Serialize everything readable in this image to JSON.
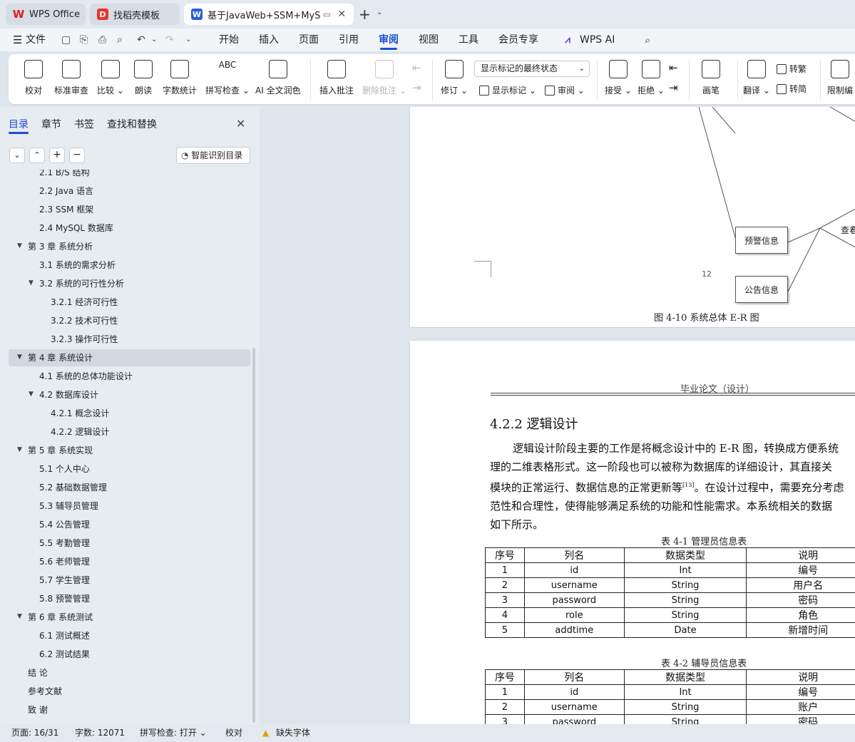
{
  "tabs": [
    {
      "label": "WPS Office",
      "icon": "wps-logo-icon",
      "color": "#d9201c"
    },
    {
      "label": "找稻壳模板",
      "icon": "docer-icon",
      "color": "#e8352e"
    },
    {
      "label": "基于JavaWeb+SSM+MySQ",
      "icon": "word-doc-icon",
      "color": "#2b5fd9"
    }
  ],
  "menu": {
    "file": "文件",
    "items": [
      "开始",
      "插入",
      "页面",
      "引用",
      "审阅",
      "视图",
      "工具",
      "会员专享"
    ],
    "active": "审阅",
    "ai": "WPS AI"
  },
  "ribbon": {
    "proofread": "校对",
    "std_review": "标准审查",
    "compare": "比较",
    "read_aloud": "朗读",
    "word_count": "字数统计",
    "spell_check": "拼写检查",
    "ai_polish": "AI 全文润色",
    "insert_comment": "插入批注",
    "delete_comment": "删除批注",
    "track_changes": "修订",
    "display_state": "显示标记的最终状态",
    "show_markup": "显示标记",
    "review": "审阅",
    "accept": "接受",
    "reject": "拒绝",
    "ink": "画笔",
    "translate": "翻译",
    "to_traditional": "转繁",
    "to_simplified": "转简",
    "restrict": "限制编"
  },
  "sidebar": {
    "tabs": [
      "目录",
      "章节",
      "书签",
      "查找和替换"
    ],
    "active_tab": "目录",
    "smart_button": "智能识别目录",
    "toc": [
      {
        "label": "2.1 B/S 结构",
        "level": 2
      },
      {
        "label": "2.2 Java 语言",
        "level": 2
      },
      {
        "label": "2.3 SSM 框架",
        "level": 2
      },
      {
        "label": "2.4 MySQL 数据库",
        "level": 2
      },
      {
        "label": "第 3 章  系统分析",
        "level": 1,
        "expanded": true
      },
      {
        "label": "3.1 系统的需求分析",
        "level": 2
      },
      {
        "label": "3.2 系统的可行性分析",
        "level": 2,
        "expanded": true
      },
      {
        "label": "3.2.1 经济可行性",
        "level": 3
      },
      {
        "label": "3.2.2 技术可行性",
        "level": 3
      },
      {
        "label": "3.2.3 操作可行性",
        "level": 3
      },
      {
        "label": "第 4 章  系统设计",
        "level": 1,
        "expanded": true,
        "selected": true
      },
      {
        "label": "4.1 系统的总体功能设计",
        "level": 2
      },
      {
        "label": "4.2 数据库设计",
        "level": 2,
        "expanded": true
      },
      {
        "label": "4.2.1 概念设计",
        "level": 3
      },
      {
        "label": "4.2.2 逻辑设计",
        "level": 3
      },
      {
        "label": "第 5 章  系统实现",
        "level": 1,
        "expanded": true
      },
      {
        "label": "5.1 个人中心",
        "level": 2
      },
      {
        "label": "5.2 基础数据管理",
        "level": 2
      },
      {
        "label": "5.3 辅导员管理",
        "level": 2
      },
      {
        "label": "5.4 公告管理",
        "level": 2
      },
      {
        "label": "5.5 考勤管理",
        "level": 2
      },
      {
        "label": "5.6 老师管理",
        "level": 2
      },
      {
        "label": "5.7 学生管理",
        "level": 2
      },
      {
        "label": "5.8 预警管理",
        "level": 2
      },
      {
        "label": "第 6 章    系统测试",
        "level": 1,
        "expanded": true
      },
      {
        "label": "6.1    测试概述",
        "level": 2
      },
      {
        "label": "6.2    测试结果",
        "level": 2
      },
      {
        "label": "结      论",
        "level": 1
      },
      {
        "label": "参考文献",
        "level": 1
      },
      {
        "label": "致      谢",
        "level": 1
      }
    ]
  },
  "page1": {
    "er_nodes": [
      "预警信息",
      "公告信息",
      "查看"
    ],
    "caption": "图 4-10 系统总体 E-R 图",
    "page_number": "12"
  },
  "page2": {
    "header": "毕业论文（设计）",
    "heading": "4.2.2 逻辑设计",
    "lines": [
      "逻辑设计阶段主要的工作是将概念设计中的 E-R 图，转换成方便系统",
      "理的二维表格形式。这一阶段也可以被称为数据库的详细设计，其直接关",
      "模块的正常运行、数据信息的正常更新等",
      "。在设计过程中，需要充分考虑",
      "范性和合理性，使得能够满足系统的功能和性能需求。本系统相关的数据",
      "如下所示。"
    ],
    "citation": "[13]",
    "table1_caption": "表 4-1  管理员信息表",
    "table2_caption": "表 4-2  辅导员信息表",
    "table_headers": [
      "序号",
      "列名",
      "数据类型",
      "说明"
    ],
    "table1_rows": [
      [
        "1",
        "id",
        "Int",
        "编号"
      ],
      [
        "2",
        "username",
        "String",
        "用户名"
      ],
      [
        "3",
        "password",
        "String",
        "密码"
      ],
      [
        "4",
        "role",
        "String",
        "角色"
      ],
      [
        "5",
        "addtime",
        "Date",
        "新增时间"
      ]
    ],
    "table2_rows": [
      [
        "1",
        "id",
        "Int",
        "编号"
      ],
      [
        "2",
        "username",
        "String",
        "账户"
      ],
      [
        "3",
        "password",
        "String",
        "密码"
      ]
    ]
  },
  "status": {
    "page": "页面: 16/31",
    "words": "字数: 12071",
    "spell": "拼写检查: 打开",
    "proof": "校对",
    "missing_font": "缺失字体"
  }
}
